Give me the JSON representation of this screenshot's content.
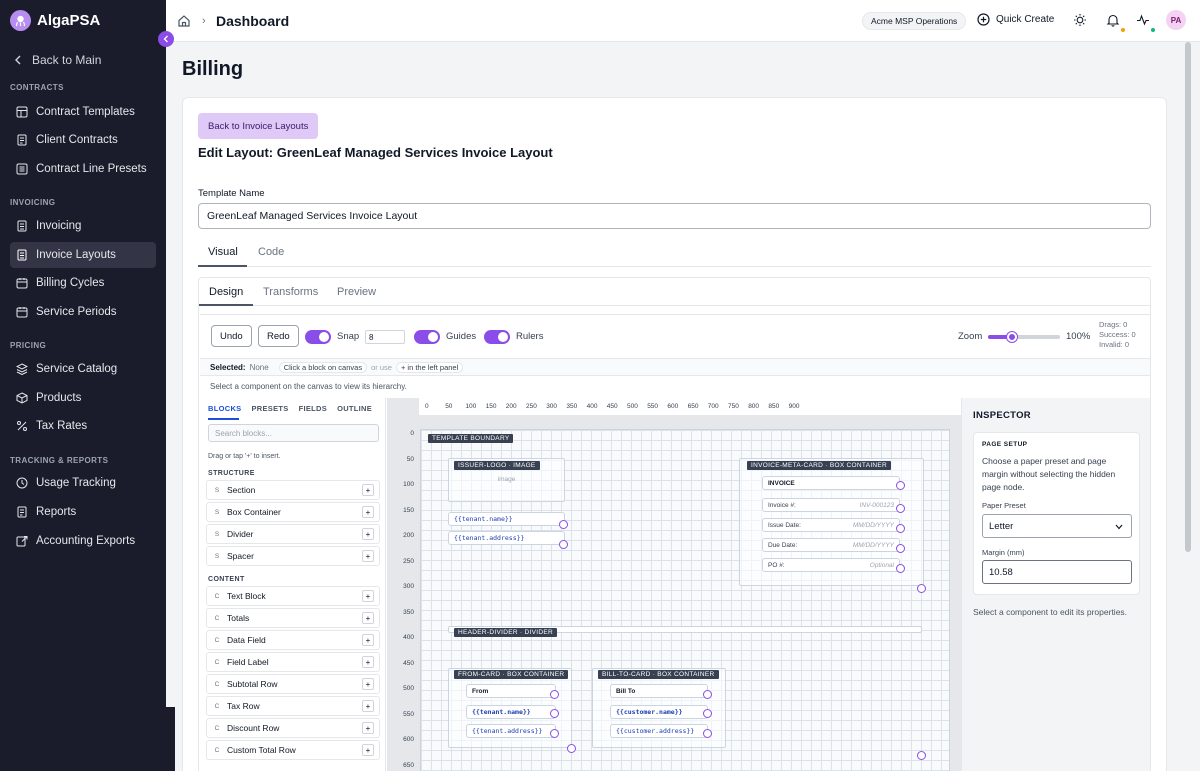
{
  "app": {
    "name": "AlgaPSA"
  },
  "sidebar": {
    "back_label": "Back to Main",
    "sections": [
      {
        "title": "CONTRACTS",
        "items": [
          {
            "label": "Contract Templates"
          },
          {
            "label": "Client Contracts"
          },
          {
            "label": "Contract Line Presets"
          }
        ]
      },
      {
        "title": "INVOICING",
        "items": [
          {
            "label": "Invoicing"
          },
          {
            "label": "Invoice Layouts"
          },
          {
            "label": "Billing Cycles"
          },
          {
            "label": "Service Periods"
          }
        ]
      },
      {
        "title": "PRICING",
        "items": [
          {
            "label": "Service Catalog"
          },
          {
            "label": "Products"
          },
          {
            "label": "Tax Rates"
          }
        ]
      },
      {
        "title": "TRACKING & REPORTS",
        "items": [
          {
            "label": "Usage Tracking"
          },
          {
            "label": "Reports"
          },
          {
            "label": "Accounting Exports"
          }
        ]
      }
    ]
  },
  "header": {
    "title": "Dashboard",
    "tenant": "Acme MSP Operations",
    "quick_create": "Quick Create",
    "avatar_initials": "PA"
  },
  "page": {
    "title": "Billing",
    "back_button": "Back to Invoice Layouts",
    "edit_title": "Edit Layout: GreenLeaf Managed Services Invoice Layout",
    "template_name_label": "Template Name",
    "template_name_value": "GreenLeaf Managed Services Invoice Layout",
    "tabs": [
      "Visual",
      "Code"
    ],
    "subtabs": [
      "Design",
      "Transforms",
      "Preview"
    ]
  },
  "toolbar": {
    "undo": "Undo",
    "redo": "Redo",
    "snap": "Snap",
    "snap_value": "8",
    "guides": "Guides",
    "rulers": "Rulers",
    "zoom_label": "Zoom",
    "zoom_value": "100%",
    "zoom_fraction": 0.33,
    "drags": "Drags: 0",
    "success": "Success: 0",
    "invalid": "Invalid: 0"
  },
  "selection": {
    "label": "Selected:",
    "value": "None",
    "hint1": "Click a block on canvas",
    "or_use": "or use",
    "hint2": "+ in the left panel",
    "hierarchy_hint": "Select a component on the canvas to view its hierarchy."
  },
  "palette": {
    "tabs": [
      "BLOCKS",
      "PRESETS",
      "FIELDS",
      "OUTLINE"
    ],
    "search_placeholder": "Search blocks...",
    "note": "Drag or tap '+' to insert.",
    "structure_title": "STRUCTURE",
    "structure": [
      {
        "badge": "S",
        "label": "Section"
      },
      {
        "badge": "S",
        "label": "Box Container"
      },
      {
        "badge": "S",
        "label": "Divider"
      },
      {
        "badge": "S",
        "label": "Spacer"
      }
    ],
    "content_title": "CONTENT",
    "content": [
      {
        "badge": "C",
        "label": "Text Block"
      },
      {
        "badge": "C",
        "label": "Totals"
      },
      {
        "badge": "C",
        "label": "Data Field"
      },
      {
        "badge": "C",
        "label": "Field Label"
      },
      {
        "badge": "C",
        "label": "Subtotal Row"
      },
      {
        "badge": "C",
        "label": "Tax Row"
      },
      {
        "badge": "C",
        "label": "Discount Row"
      },
      {
        "badge": "C",
        "label": "Custom Total Row"
      }
    ],
    "plus": "+"
  },
  "canvas": {
    "ruler_x": [
      "0",
      "50",
      "100",
      "150",
      "200",
      "250",
      "300",
      "350",
      "400",
      "450",
      "500",
      "550",
      "600",
      "650",
      "700",
      "750",
      "800",
      "850",
      "900"
    ],
    "ruler_y": [
      "0",
      "50",
      "100",
      "150",
      "200",
      "250",
      "300",
      "350",
      "400",
      "450",
      "500",
      "550",
      "600",
      "650"
    ],
    "template_boundary": "TEMPLATE BOUNDARY",
    "issuer_logo": "ISSUER-LOGO · IMAGE",
    "image_placeholder": "image",
    "tenant_name": "{{tenant.name}}",
    "tenant_address": "{{tenant.address}}",
    "meta_card": "INVOICE-META-CARD · BOX CONTAINER",
    "invoice_heading": "INVOICE",
    "meta_rows": [
      {
        "label": "Invoice #:",
        "placeholder": "INV-000123"
      },
      {
        "label": "Issue Date:",
        "placeholder": "MM/DD/YYYY"
      },
      {
        "label": "Due Date:",
        "placeholder": "MM/DD/YYYY"
      },
      {
        "label": "PO #:",
        "placeholder": "Optional"
      }
    ],
    "header_divider": "HEADER-DIVIDER · DIVIDER",
    "from_card": "FROM-CARD · BOX CONTAINER",
    "from_label": "From",
    "bill_to_card": "BILL-TO-CARD · BOX CONTAINER",
    "bill_to_label": "Bill To",
    "customer_name": "{{customer.name}}",
    "customer_address": "{{customer.address}}"
  },
  "inspector": {
    "title": "INSPECTOR",
    "page_setup": "PAGE SETUP",
    "description": "Choose a paper preset and page margin without selecting the hidden page node.",
    "paper_label": "Paper Preset",
    "paper_value": "Letter",
    "margin_label": "Margin (mm)",
    "margin_value": "10.58",
    "footer": "Select a component to edit its properties."
  }
}
